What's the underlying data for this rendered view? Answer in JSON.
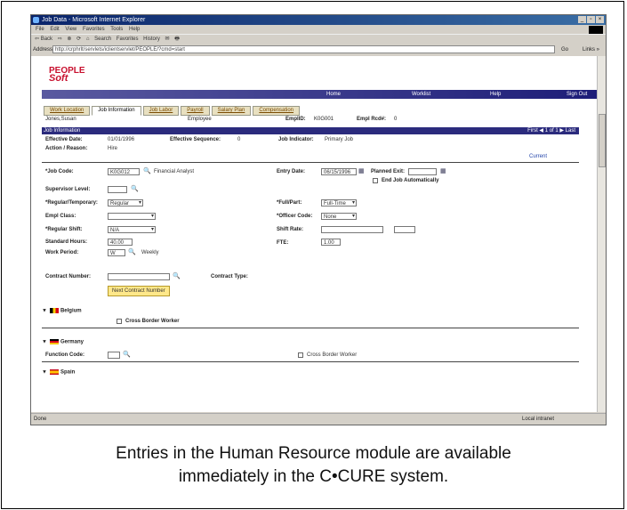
{
  "caption": {
    "line1": "Entries in the Human Resource module are available",
    "line2": "immediately in the C•CURE system."
  },
  "window": {
    "title": "Job Data - Microsoft Internet Explorer",
    "controls": [
      "_",
      "▫",
      "×"
    ],
    "menu": [
      "File",
      "Edit",
      "View",
      "Favorites",
      "Tools",
      "Help"
    ],
    "toolbar": [
      "⇦ Back",
      "⇨",
      "⊗",
      "⟳",
      "⌂",
      "Search",
      "Favorites",
      "History",
      "✉",
      "🖶"
    ],
    "address_label": "Address",
    "address_value": "http://crphrlt/servlets/iclientservlet/PEOPLE/?cmd=start",
    "go_label": "Go",
    "links_label": "Links »",
    "status_left": "Done",
    "status_right": "Local intranet"
  },
  "logo": {
    "line1": "PEOPLE",
    "line2": "Soft"
  },
  "nav": {
    "home": "Home",
    "worklist": "Worklist",
    "help": "Help",
    "signout": "Sign Out"
  },
  "tabs": [
    "Work Location",
    "Job Information",
    "Job Labor",
    "Payroll",
    "Salary Plan",
    "Compensation"
  ],
  "employee": {
    "name": "Jones,Susan",
    "type": "Employee",
    "emplid_label": "EmplID:",
    "emplid": "K0G001",
    "rcd_label": "Empl Rcd#:",
    "rcd": "0"
  },
  "section": {
    "title": "Job Information",
    "nav": "First ◀ 1 of 1 ▶ Last"
  },
  "header": {
    "effdate_label": "Effective Date:",
    "effdate": "01/01/1996",
    "effseq_label": "Effective Sequence:",
    "effseq": "0",
    "jobind_label": "Job Indicator:",
    "jobind": "Primary Job",
    "action_label": "Action / Reason:",
    "action": "Hire",
    "current": "Current"
  },
  "fields": {
    "jobcode_label": "*Job Code:",
    "jobcode": "K0G012",
    "jobcode_desc": "Financial Analyst",
    "entrydate_label": "Entry Date:",
    "entrydate": "06/15/1996",
    "plannedexit_label": "Planned Exit:",
    "plannedexit": "",
    "endjob_label": "End Job Automatically",
    "suplevel_label": "Supervisor Level:",
    "suplevel": "",
    "regtemp_label": "*Regular/Temporary:",
    "regtemp": "Regular",
    "fullpart_label": "*Full/Part:",
    "fullpart": "Full-Time",
    "emplclass_label": "Empl Class:",
    "emplclass": "",
    "officer_label": "*Officer Code:",
    "officer": "None",
    "regshift_label": "*Regular Shift:",
    "regshift": "N/A",
    "shiftrate_label": "Shift Rate:",
    "shiftrate": "",
    "stdhours_label": "Standard Hours:",
    "stdhours": "40.00",
    "fte_label": "FTE:",
    "fte": "1.00",
    "workperiod_label": "Work Period:",
    "workperiod": "W",
    "workperiod_desc": "Weekly",
    "contract_label": "Contract Number:",
    "contract": "",
    "contracttype_label": "Contract Type:",
    "nextcontract_button": "Next Contract Number"
  },
  "countries": {
    "belgium": "Belgium",
    "belgium_cross": "Cross Border Worker",
    "germany": "Germany",
    "function_label": "Function Code:",
    "germany_cross": "Cross Border Worker",
    "spain": "Spain"
  }
}
